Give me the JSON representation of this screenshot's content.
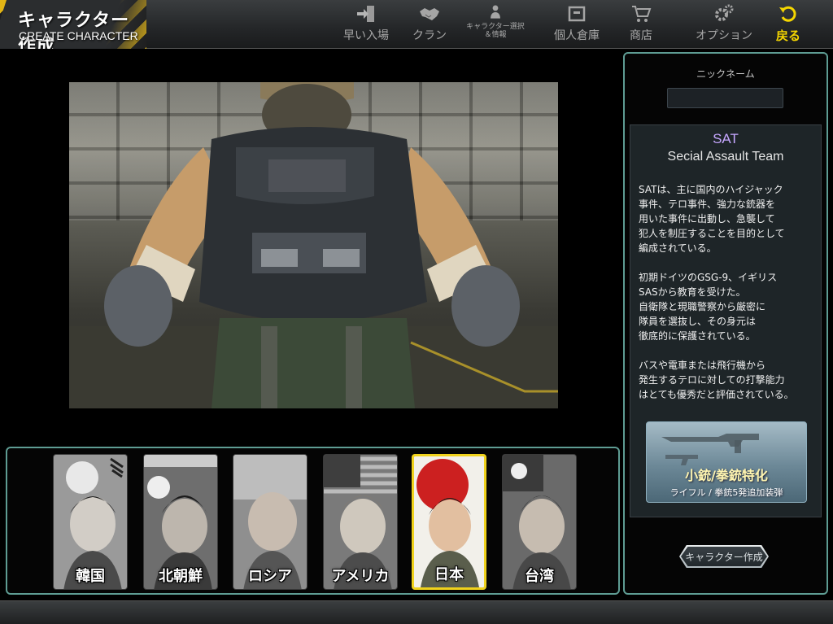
{
  "header": {
    "title_jp": "キャラクター作成",
    "title_en": "CREATE CHARACTER"
  },
  "nav": [
    {
      "label": "早い入場",
      "icon": "quick-enter-icon"
    },
    {
      "label": "クラン",
      "icon": "handshake-icon"
    },
    {
      "label": "キャラクター選択\n＆情報",
      "icon": "info-icon"
    },
    {
      "label": "個人倉庫",
      "icon": "warehouse-icon"
    },
    {
      "label": "商店",
      "icon": "cart-icon"
    },
    {
      "label": "オプション",
      "icon": "gears-icon"
    },
    {
      "label": "戻る",
      "icon": "back-arrow-icon"
    }
  ],
  "characters": [
    {
      "label": "韓国",
      "flag": "korea"
    },
    {
      "label": "北朝鮮",
      "flag": "north-korea"
    },
    {
      "label": "ロシア",
      "flag": "russia"
    },
    {
      "label": "アメリカ",
      "flag": "usa"
    },
    {
      "label": "日本",
      "flag": "japan",
      "selected": true
    },
    {
      "label": "台湾",
      "flag": "taiwan"
    }
  ],
  "right_panel": {
    "nickname_label": "ニックネーム",
    "nickname_value": "",
    "team_code": "SAT",
    "team_name": "Secial Assault Team",
    "team_description": "SATは、主に国内のハイジャック\n事件、テロ事件、強力な銃器を\n用いた事件に出動し、急襲して\n犯人を制圧することを目的として\n編成されている。\n\n初期ドイツのGSG-9、イギリス\nSASから教育を受けた。\n自衛隊と現職警察から厳密に\n隊員を選抜し、その身元は\n徹底的に保護されている。\n\nバスや電車または飛行機から\n発生するテロに対しての打撃能力\nはとても優秀だと評価されている。",
    "weapon_title": "小銃/拳銃特化",
    "weapon_sub": "ライフル / 拳銃5発追加装弾",
    "create_button": "キャラクター作成"
  },
  "colors": {
    "accent_border": "#5e9c93",
    "selected_border": "#f0d21c",
    "back_label": "#f5d600",
    "team_code": "#c6a7ff"
  }
}
